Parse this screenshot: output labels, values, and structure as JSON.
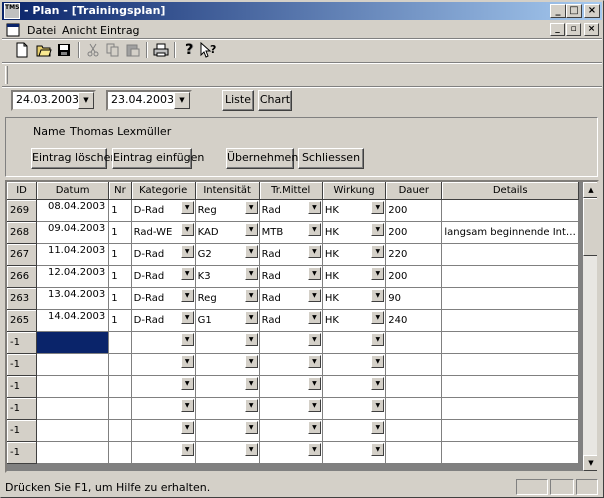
{
  "window": {
    "title": "- Plan - [Trainingsplan]",
    "app_icon_text": "TMS"
  },
  "menu": {
    "items": [
      "Datei",
      "Anicht",
      "Eintrag"
    ]
  },
  "toolbar": {
    "icons": [
      "new-file-icon",
      "open-folder-icon",
      "save-icon",
      "cut-icon",
      "copy-icon",
      "paste-icon",
      "print-icon",
      "help-icon",
      "context-help-icon"
    ]
  },
  "filter": {
    "from_date": "24.03.2003",
    "to_date": "23.04.2003",
    "list_label": "Liste",
    "chart_label": "Chart"
  },
  "form": {
    "name_label": "Name",
    "name_value": "Thomas Lexmüller",
    "delete_label": "Eintrag löschen",
    "insert_label": "Eintrag einfügen",
    "apply_label": "Übernehmen",
    "close_label": "Schliessen"
  },
  "grid": {
    "columns": [
      "ID",
      "Datum",
      "Nr",
      "Kategorie",
      "Intensität",
      "Tr.Mittel",
      "Wirkung",
      "Dauer",
      "Details"
    ],
    "rows": [
      {
        "id": "269",
        "date": "08.04.2003",
        "nr": "1",
        "kat": "D-Rad",
        "int": "Reg",
        "mittel": "Rad",
        "wirk": "HK",
        "dauer": "200",
        "details": ""
      },
      {
        "id": "268",
        "date": "09.04.2003",
        "nr": "1",
        "kat": "Rad-WE",
        "int": "KAD",
        "mittel": "MTB",
        "wirk": "HK",
        "dauer": "200",
        "details": "langsam beginnende Int…"
      },
      {
        "id": "267",
        "date": "11.04.2003",
        "nr": "1",
        "kat": "D-Rad",
        "int": "G2",
        "mittel": "Rad",
        "wirk": "HK",
        "dauer": "220",
        "details": ""
      },
      {
        "id": "266",
        "date": "12.04.2003",
        "nr": "1",
        "kat": "D-Rad",
        "int": "K3",
        "mittel": "Rad",
        "wirk": "HK",
        "dauer": "200",
        "details": ""
      },
      {
        "id": "263",
        "date": "13.04.2003",
        "nr": "1",
        "kat": "D-Rad",
        "int": "Reg",
        "mittel": "Rad",
        "wirk": "HK",
        "dauer": "90",
        "details": ""
      },
      {
        "id": "265",
        "date": "14.04.2003",
        "nr": "1",
        "kat": "D-Rad",
        "int": "G1",
        "mittel": "Rad",
        "wirk": "HK",
        "dauer": "240",
        "details": ""
      },
      {
        "id": "-1",
        "date": "",
        "nr": "",
        "kat": "",
        "int": "",
        "mittel": "",
        "wirk": "",
        "dauer": "",
        "details": ""
      },
      {
        "id": "-1",
        "date": "",
        "nr": "",
        "kat": "",
        "int": "",
        "mittel": "",
        "wirk": "",
        "dauer": "",
        "details": ""
      },
      {
        "id": "-1",
        "date": "",
        "nr": "",
        "kat": "",
        "int": "",
        "mittel": "",
        "wirk": "",
        "dauer": "",
        "details": ""
      },
      {
        "id": "-1",
        "date": "",
        "nr": "",
        "kat": "",
        "int": "",
        "mittel": "",
        "wirk": "",
        "dauer": "",
        "details": ""
      },
      {
        "id": "-1",
        "date": "",
        "nr": "",
        "kat": "",
        "int": "",
        "mittel": "",
        "wirk": "",
        "dauer": "",
        "details": ""
      },
      {
        "id": "-1",
        "date": "",
        "nr": "",
        "kat": "",
        "int": "",
        "mittel": "",
        "wirk": "",
        "dauer": "",
        "details": ""
      }
    ]
  },
  "status": {
    "text": "Drücken Sie F1, um Hilfe zu erhalten."
  },
  "colors": {
    "titlebar": "#0a246a",
    "selection": "#0a246a",
    "face": "#d4d0c8"
  }
}
